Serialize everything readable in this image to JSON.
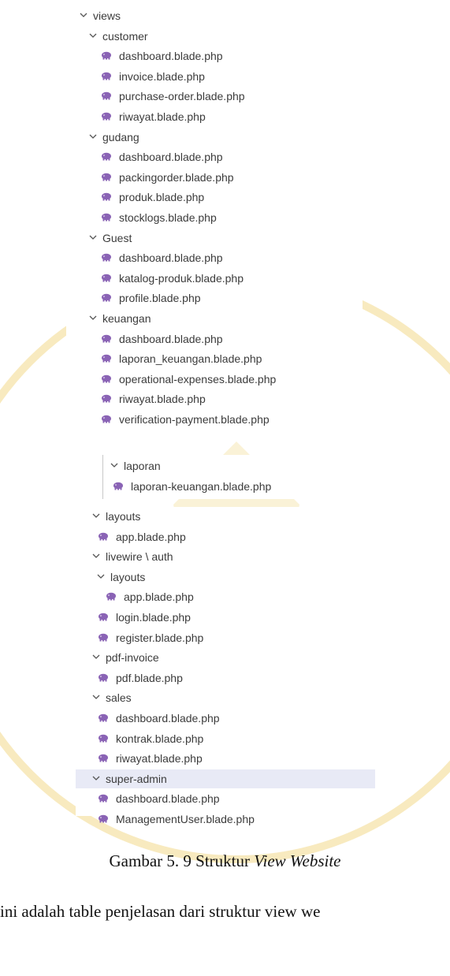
{
  "tree_panel_1": {
    "rows": [
      {
        "label": "views",
        "type": "folder"
      },
      {
        "label": "customer",
        "type": "folder"
      },
      {
        "label": "dashboard.blade.php",
        "type": "file"
      },
      {
        "label": "invoice.blade.php",
        "type": "file"
      },
      {
        "label": "purchase-order.blade.php",
        "type": "file"
      },
      {
        "label": "riwayat.blade.php",
        "type": "file"
      },
      {
        "label": "gudang",
        "type": "folder"
      },
      {
        "label": "dashboard.blade.php",
        "type": "file"
      },
      {
        "label": "packingorder.blade.php",
        "type": "file"
      },
      {
        "label": "produk.blade.php",
        "type": "file"
      },
      {
        "label": "stocklogs.blade.php",
        "type": "file"
      },
      {
        "label": "Guest",
        "type": "folder"
      },
      {
        "label": "dashboard.blade.php",
        "type": "file"
      },
      {
        "label": "katalog-produk.blade.php",
        "type": "file"
      },
      {
        "label": "profile.blade.php",
        "type": "file"
      },
      {
        "label": "keuangan",
        "type": "folder"
      },
      {
        "label": "dashboard.blade.php",
        "type": "file"
      },
      {
        "label": "laporan_keuangan.blade.php",
        "type": "file"
      },
      {
        "label": "operational-expenses.blade.php",
        "type": "file"
      },
      {
        "label": "riwayat.blade.php",
        "type": "file"
      },
      {
        "label": "verification-payment.blade.php",
        "type": "file"
      }
    ]
  },
  "tree_panel_2": {
    "rows": [
      {
        "label": "laporan",
        "type": "folder"
      },
      {
        "label": "laporan-keuangan.blade.php",
        "type": "file"
      }
    ]
  },
  "tree_panel_3": {
    "rows": [
      {
        "label": "layouts",
        "type": "folder"
      },
      {
        "label": "app.blade.php",
        "type": "file"
      },
      {
        "label": "livewire \\ auth",
        "type": "folder"
      },
      {
        "label": "layouts",
        "type": "folder"
      },
      {
        "label": "app.blade.php",
        "type": "file"
      },
      {
        "label": "login.blade.php",
        "type": "file"
      },
      {
        "label": "register.blade.php",
        "type": "file"
      },
      {
        "label": "pdf-invoice",
        "type": "folder"
      },
      {
        "label": "pdf.blade.php",
        "type": "file"
      },
      {
        "label": "sales",
        "type": "folder"
      },
      {
        "label": "dashboard.blade.php",
        "type": "file"
      },
      {
        "label": "kontrak.blade.php",
        "type": "file"
      },
      {
        "label": "riwayat.blade.php",
        "type": "file"
      },
      {
        "label": "super-admin",
        "type": "folder"
      },
      {
        "label": "dashboard.blade.php",
        "type": "file"
      },
      {
        "label": "ManagementUser.blade.php",
        "type": "file"
      }
    ]
  },
  "caption": {
    "prefix": "Gambar 5. 9 Struktur ",
    "italic": "View Website"
  },
  "body_text": "ini adalah table penjelasan dari struktur view we",
  "colors": {
    "php_icon": "#8a63b5",
    "selected_row": "#e8eaf6",
    "watermark": "#f3d88a"
  },
  "icons": {
    "folder_expanded": "chevron-down-icon",
    "file": "php-elephant-icon"
  }
}
